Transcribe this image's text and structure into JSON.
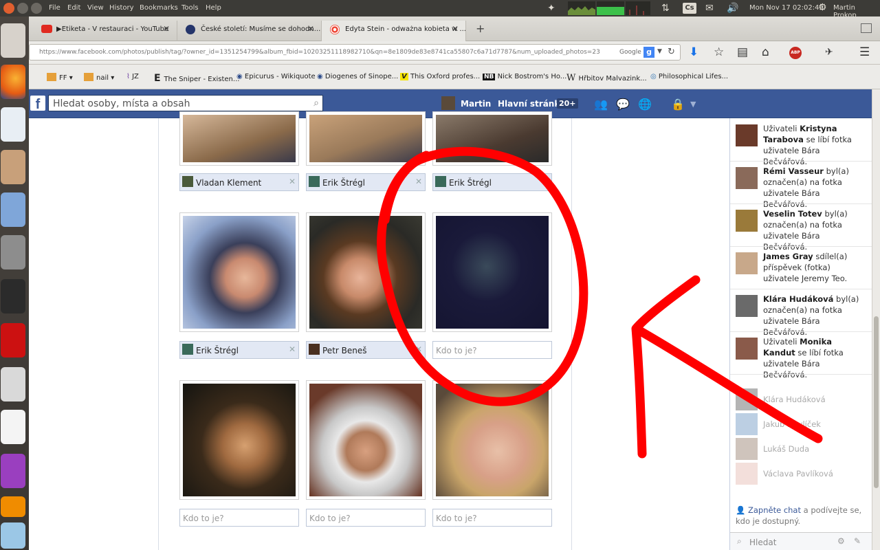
{
  "panel": {
    "menu": [
      "File",
      "Edit",
      "View",
      "History",
      "Bookmarks",
      "Tools",
      "Help"
    ],
    "clock": "Mon Nov 17 02:02:43",
    "user": "Martin Prokop",
    "keyboard": "Cs"
  },
  "tabs": [
    {
      "title": "▶Etiketa - V restauraci - YouTube",
      "icon": "youtube-icon"
    },
    {
      "title": "České století: Musíme se dohodn...",
      "icon": "ct-icon"
    },
    {
      "title": "Edyta Stein - odważna kobieta w ...",
      "icon": "target-icon"
    }
  ],
  "url": {
    "value": "https://www.facebook.com/photos/publish/tag/?owner_id=1351254799&album_fbid=10203251118982710&qn=8e1809de83e8741ca55807c6a71d7787&num_uploaded_photos=23",
    "search_engine": "Google"
  },
  "bookmarks": [
    "FF",
    "nail",
    "JZ",
    "The Sniper - Existen...",
    "Epicurus - Wikiquote",
    "Diogenes of Sinope...",
    "This Oxford profes...",
    "Nick Bostrom's Ho...",
    "Hřbitov Malvazink...",
    "Philosophical Lifes..."
  ],
  "facebook": {
    "search_placeholder": "Hledat osoby, místa a obsah",
    "user": "Martin",
    "home": "Hlavní stránka",
    "home_badge": "20+"
  },
  "photo_tags": {
    "row1": [
      {
        "name": "Vladan Klement"
      },
      {
        "name": "Erik Štrégl"
      },
      {
        "name": "Erik Štrégl"
      }
    ],
    "row2": [
      {
        "name": "Erik Štrégl"
      },
      {
        "name": "Petr Beneš"
      },
      {
        "placeholder": "Kdo to je?"
      }
    ],
    "row3": [
      {
        "placeholder": "Kdo to je?"
      },
      {
        "placeholder": "Kdo to je?"
      },
      {
        "placeholder": "Kdo to je?"
      }
    ]
  },
  "ticker": [
    {
      "pre": "Uživateli ",
      "name": "Kristyna Tarabova",
      "post": " se líbí fotka uživatele Bára Bečvářová."
    },
    {
      "pre": "",
      "name": "Rémi Vasseur",
      "post": " byl(a) označen(a) na fotka uživatele Bára Bečvářová."
    },
    {
      "pre": "",
      "name": "Veselin Totev",
      "post": " byl(a) označen(a) na fotka uživatele Bára Bečvářová."
    },
    {
      "pre": "",
      "name": "James Gray",
      "post": " sdílel(a) příspěvek (fotka) uživatele Jeremy Teo."
    },
    {
      "pre": "",
      "name": "Klára Hudáková",
      "post": " byl(a) označen(a) na fotka uživatele Bára Bečvářová."
    },
    {
      "pre": "Uživateli ",
      "name": "Monika Kandut",
      "post": " se líbí fotka uživatele Bára Bečvářová."
    }
  ],
  "chat_friends": [
    "Klára Hudáková",
    "Jakub Havlíček",
    "Lukáš Duda",
    "Václava Pavlíková"
  ],
  "chat": {
    "link": "Zapněte chat",
    "note": " a podívejte se, kdo je dostupný.",
    "search": "Hledat"
  },
  "colors": {
    "fb_blue": "#3b5998",
    "annotation_red": "#ff0000"
  }
}
